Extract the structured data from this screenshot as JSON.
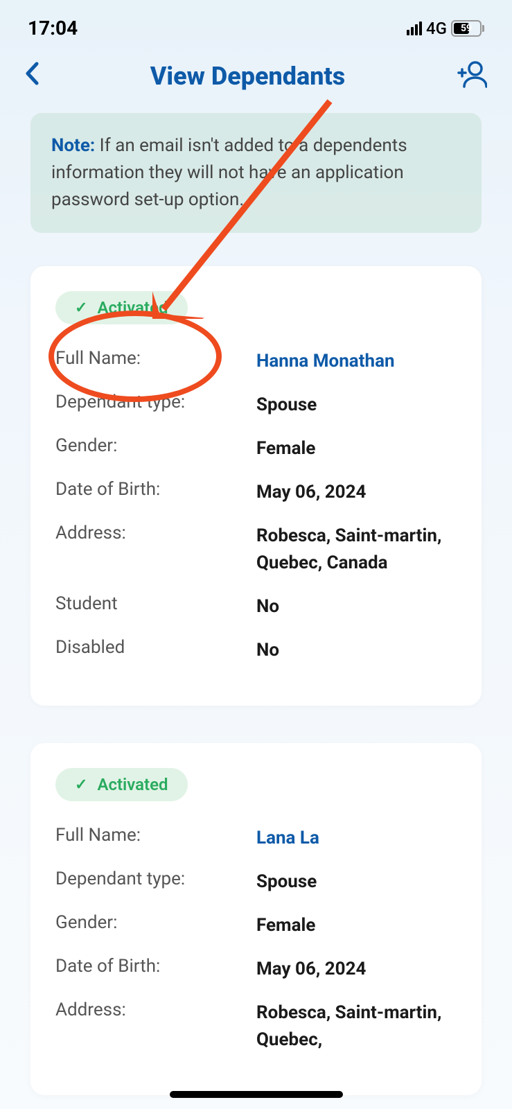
{
  "status_bar": {
    "time": "17:04",
    "network": "4G",
    "battery": "59"
  },
  "header": {
    "title": "View Dependants"
  },
  "note": {
    "label": "Note:",
    "text": " If an email isn't added to a dependents information they will not have an application password set-up option."
  },
  "dependants": [
    {
      "status": "Activated",
      "fields": [
        {
          "label": "Full Name:",
          "value": "Hanna Monathan",
          "highlight": true
        },
        {
          "label": "Dependant type:",
          "value": "Spouse"
        },
        {
          "label": "Gender:",
          "value": "Female"
        },
        {
          "label": "Date of Birth:",
          "value": "May 06, 2024"
        },
        {
          "label": "Address:",
          "value": "Robesca, Saint-martin, Quebec, Canada"
        },
        {
          "label": "Student",
          "value": "No"
        },
        {
          "label": "Disabled",
          "value": "No"
        }
      ]
    },
    {
      "status": "Activated",
      "fields": [
        {
          "label": "Full Name:",
          "value": "Lana La",
          "highlight": true
        },
        {
          "label": "Dependant type:",
          "value": "Spouse"
        },
        {
          "label": "Gender:",
          "value": "Female"
        },
        {
          "label": "Date of Birth:",
          "value": "May 06, 2024"
        },
        {
          "label": "Address:",
          "value": "Robesca, Saint-martin, Quebec,"
        }
      ]
    }
  ]
}
